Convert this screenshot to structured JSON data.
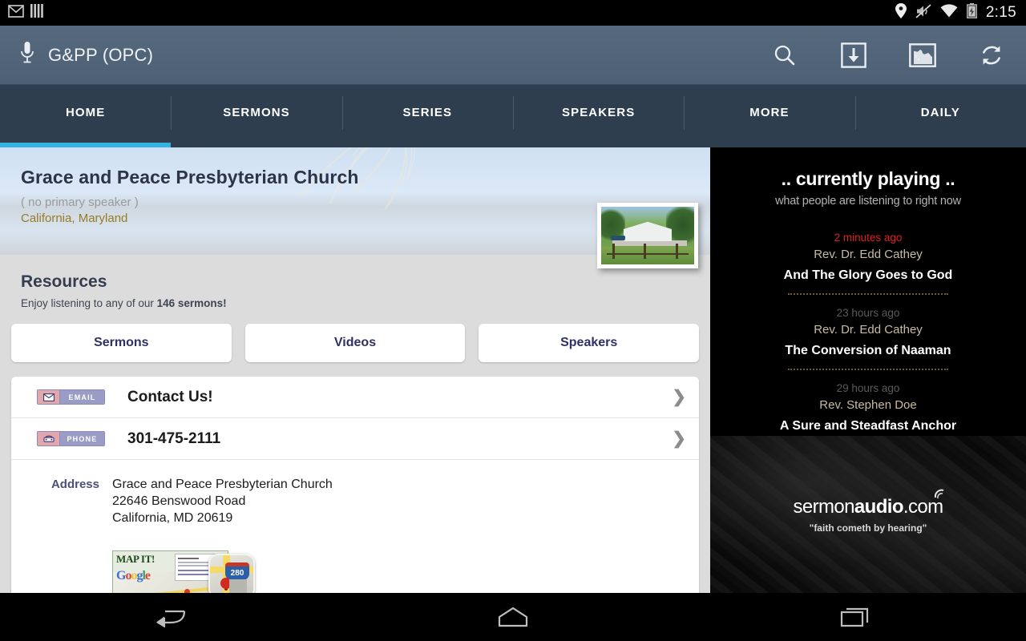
{
  "statusbar": {
    "clock": "2:15",
    "left_icons": [
      "gmail-icon",
      "sim-bars-icon"
    ],
    "right_icons": [
      "location-pin-icon",
      "volume-mute-icon",
      "wifi-icon",
      "battery-charging-icon"
    ]
  },
  "actionbar": {
    "title": "G&PP (OPC)",
    "mic_icon": "microphone-icon",
    "actions": [
      {
        "name": "search-icon",
        "label": "Search"
      },
      {
        "name": "download-icon",
        "label": "Download"
      },
      {
        "name": "world-map-icon",
        "label": "Map"
      },
      {
        "name": "refresh-icon",
        "label": "Refresh"
      }
    ]
  },
  "tabs": [
    {
      "label": "HOME",
      "active": true
    },
    {
      "label": "SERMONS",
      "active": false
    },
    {
      "label": "SERIES",
      "active": false
    },
    {
      "label": "SPEAKERS",
      "active": false
    },
    {
      "label": "MORE",
      "active": false
    },
    {
      "label": "DAILY",
      "active": false
    }
  ],
  "header": {
    "church_name": "Grace and Peace Presbyterian Church",
    "primary_speaker": "( no primary speaker )",
    "location": "California, Maryland"
  },
  "resources": {
    "title": "Resources",
    "subtitle_prefix": "Enjoy listening to any of our ",
    "subtitle_count": "146 sermons!",
    "buttons": [
      {
        "label": "Sermons"
      },
      {
        "label": "Videos"
      },
      {
        "label": "Speakers"
      }
    ]
  },
  "contact": {
    "rows": [
      {
        "badge": "EMAIL",
        "badge_icon": "envelope-icon",
        "label": "Contact Us!"
      },
      {
        "badge": "PHONE",
        "badge_icon": "telephone-icon",
        "label": "301-475-2111"
      }
    ],
    "address_key": "Address",
    "address_lines": [
      "Grace and Peace Presbyterian Church",
      "22646 Benswood Road",
      "California, MD 20619"
    ],
    "map_it_label": "MAP IT!",
    "map_brand": "Google",
    "map_shield_number": "280"
  },
  "sidebar": {
    "title": ".. currently playing ..",
    "subtitle": "what people are listening to right now",
    "items": [
      {
        "ago": "2 minutes ago",
        "recent": true,
        "speaker": "Rev. Dr. Edd Cathey",
        "sermon": "And The Glory Goes to God"
      },
      {
        "ago": "23 hours ago",
        "recent": false,
        "speaker": "Rev. Dr. Edd Cathey",
        "sermon": "The Conversion of Naaman"
      },
      {
        "ago": "29 hours ago",
        "recent": false,
        "speaker": "Rev. Stephen Doe",
        "sermon": "A Sure and Steadfast Anchor"
      }
    ],
    "brand_first": "sermon",
    "brand_second": "audio",
    "brand_suffix": ".com",
    "brand_tagline": "\"faith cometh by hearing\""
  },
  "navbar": {
    "buttons": [
      {
        "name": "back-icon",
        "label": "Back"
      },
      {
        "name": "home-icon",
        "label": "Home"
      },
      {
        "name": "recents-icon",
        "label": "Recents"
      }
    ]
  },
  "colors": {
    "accent_tab": "#34b3e0",
    "actionbar": "#56697d",
    "tabbar": "#2f3e4e",
    "location_text": "#9a7a22",
    "recent_badge": "#e02020",
    "button_text": "#2f3063"
  }
}
